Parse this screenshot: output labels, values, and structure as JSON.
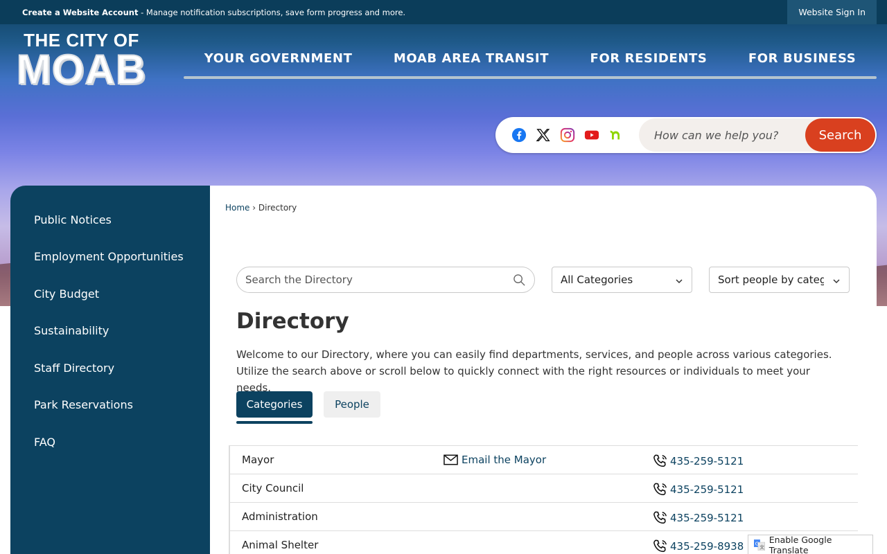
{
  "topbar": {
    "create_account": "Create a Website Account",
    "message": " - Manage notification subscriptions, save form progress and more.",
    "sign_in": "Website Sign In"
  },
  "logo": {
    "line1": "THE CITY OF",
    "line2": "MOAB"
  },
  "nav": {
    "items": [
      {
        "label": "YOUR GOVERNMENT"
      },
      {
        "label": "MOAB AREA TRANSIT"
      },
      {
        "label": "FOR RESIDENTS"
      },
      {
        "label": "FOR BUSINESS"
      }
    ]
  },
  "social": {
    "icons": [
      "facebook-icon",
      "x-icon",
      "instagram-icon",
      "youtube-icon",
      "nextdoor-icon"
    ]
  },
  "search": {
    "placeholder": "How can we help you?",
    "button": "Search",
    "accent": "#d9401f"
  },
  "sidebar": {
    "items": [
      {
        "label": "Public Notices"
      },
      {
        "label": "Employment Opportunities"
      },
      {
        "label": "City Budget"
      },
      {
        "label": "Sustainability"
      },
      {
        "label": "Staff Directory"
      },
      {
        "label": "Park Reservations"
      },
      {
        "label": "FAQ"
      }
    ]
  },
  "breadcrumb": {
    "home": "Home",
    "separator": "›",
    "current": "Directory"
  },
  "directory": {
    "search_placeholder": "Search the Directory",
    "category_select": "All Categories",
    "sort_select": "Sort people by category",
    "title": "Directory",
    "intro": "Welcome to our Directory, where you can easily find departments, services, and people across various categories. Utilize the search above or scroll below to quickly connect with the right resources or individuals to meet your needs.",
    "tabs": {
      "categories": "Categories",
      "people": "People"
    },
    "rows": [
      {
        "name": "Mayor",
        "email": "Email the Mayor",
        "phone": "435-259-5121"
      },
      {
        "name": "City Council",
        "email": "",
        "phone": "435-259-5121"
      },
      {
        "name": "Administration",
        "email": "",
        "phone": "435-259-5121"
      },
      {
        "name": "Animal Shelter",
        "email": "",
        "phone": "435-259-8938"
      }
    ]
  },
  "translate": {
    "label": "Enable Google Translate"
  },
  "colors": {
    "primary": "#0c4260",
    "topbar": "#0b3d5a"
  }
}
